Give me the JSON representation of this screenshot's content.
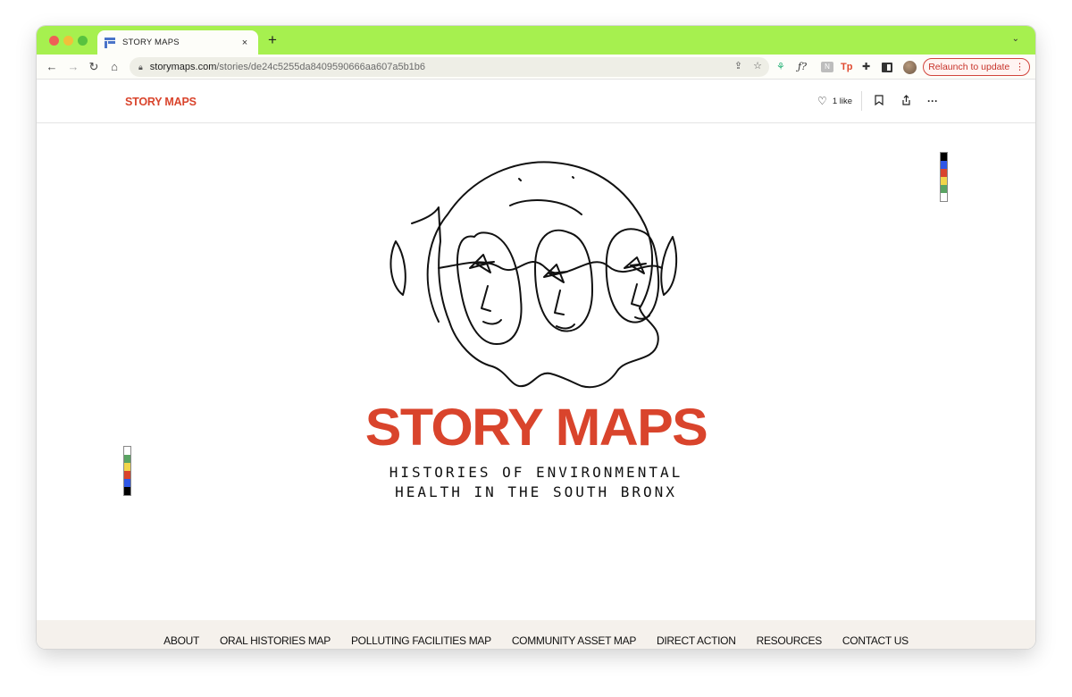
{
  "browser": {
    "tab_title": "STORY MAPS",
    "new_tab_symbol": "+",
    "tab_close_symbol": "×",
    "tab_menu_symbol": "⌄",
    "url_host": "storymaps.com",
    "url_path": "/stories/de24c5255da8409590666aa607a5b1b6",
    "relaunch_label": "Relaunch to update",
    "accent_color": "#a6f04f",
    "icons": [
      "back-icon",
      "forward-icon",
      "reload-icon",
      "home-icon",
      "lock-icon",
      "share-icon",
      "star-icon",
      "extension-icon",
      "formula-icon",
      "puzzle-icon",
      "sidepanel-icon",
      "avatar"
    ]
  },
  "site": {
    "logo": "STORY MAPS",
    "likes_label": "1 like",
    "brand_color": "#d9442c"
  },
  "hero": {
    "title": "STORY MAPS",
    "subtitle_line1": "HISTORIES OF ENVIRONMENTAL",
    "subtitle_line2": "HEALTH IN THE SOUTH BRONX",
    "colorbar_colors": [
      "#000000",
      "#2f57e6",
      "#d9442c",
      "#f1d54a",
      "#5aa463",
      "#ffffff"
    ]
  },
  "footer_nav": {
    "items": [
      "ABOUT",
      "ORAL HISTORIES MAP",
      "POLLUTING FACILITIES MAP",
      "COMMUNITY ASSET MAP",
      "DIRECT ACTION",
      "RESOURCES",
      "CONTACT US"
    ]
  }
}
